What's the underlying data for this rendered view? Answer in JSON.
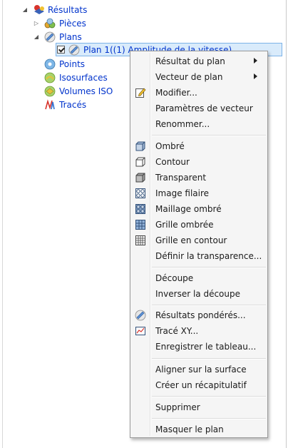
{
  "tree": {
    "root": {
      "label": "Résultats"
    },
    "pieces": {
      "label": "Pièces"
    },
    "plans": {
      "label": "Plans"
    },
    "plan1": {
      "label": "Plan 1((1) Amplitude de la vitesse)"
    },
    "points": {
      "label": "Points"
    },
    "isosurfaces": {
      "label": "Isosurfaces"
    },
    "volumes_iso": {
      "label": "Volumes ISO"
    },
    "traces": {
      "label": "Tracés"
    }
  },
  "menu": {
    "items": [
      {
        "label": "Résultat du plan",
        "submenu": true
      },
      {
        "label": "Vecteur de plan",
        "submenu": true
      },
      {
        "label": "Modifier...",
        "icon": "edit-icon"
      },
      {
        "label": "Paramètres de vecteur"
      },
      {
        "label": "Renommer..."
      },
      {
        "label": "Ombré",
        "icon": "shaded-cube-icon"
      },
      {
        "label": "Contour",
        "icon": "contour-cube-icon"
      },
      {
        "label": "Transparent",
        "icon": "transparent-cube-icon"
      },
      {
        "label": "Image filaire",
        "icon": "wireframe-icon"
      },
      {
        "label": "Maillage ombré",
        "icon": "shaded-mesh-icon"
      },
      {
        "label": "Grille ombrée",
        "icon": "shaded-grid-icon"
      },
      {
        "label": "Grille en contour",
        "icon": "contour-grid-icon"
      },
      {
        "label": "Définir la transparence..."
      },
      {
        "label": "Découpe"
      },
      {
        "label": "Inverser la découpe"
      },
      {
        "label": "Résultats pondérés...",
        "icon": "weighted-results-icon"
      },
      {
        "label": "Tracé XY...",
        "icon": "xy-plot-icon"
      },
      {
        "label": "Enregistrer le tableau..."
      },
      {
        "label": "Aligner sur la surface"
      },
      {
        "label": "Créer un récapitulatif"
      },
      {
        "label": "Supprimer"
      },
      {
        "label": "Masquer le plan"
      }
    ]
  },
  "colors": {
    "tree_link": "#0033cc",
    "selection_bg": "#d9ebfb",
    "selection_border": "#7db3e8",
    "menu_bg": "#f5f5f5"
  }
}
